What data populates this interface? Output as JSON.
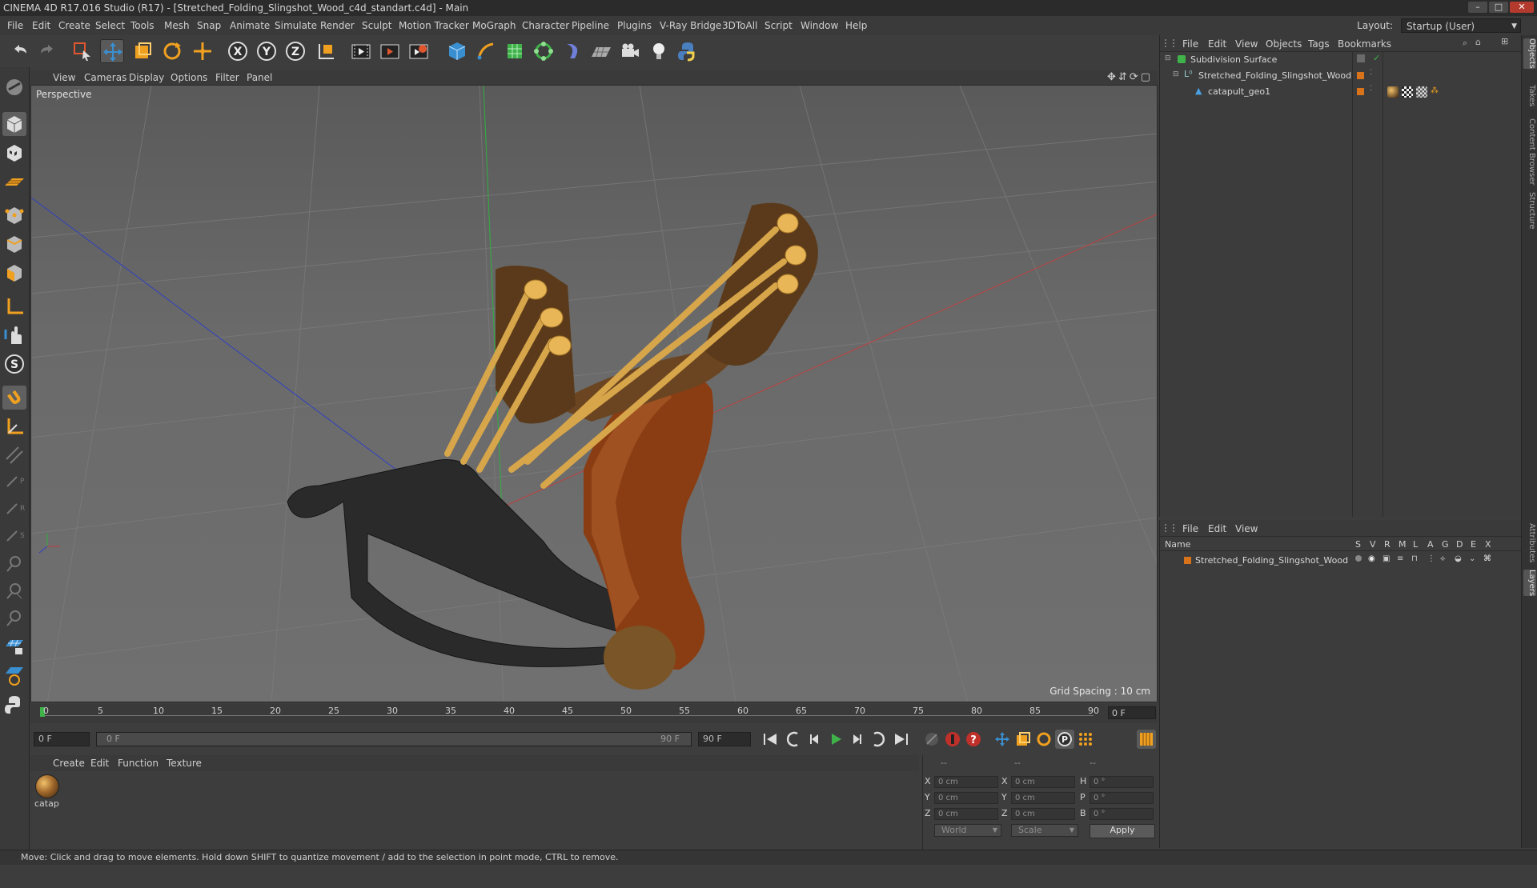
{
  "window": {
    "title": "CINEMA 4D R17.016 Studio (R17) - [Stretched_Folding_Slingshot_Wood_c4d_standart.c4d] - Main",
    "buttons": [
      "–",
      "□",
      "✕"
    ]
  },
  "menubar": {
    "items": [
      "File",
      "Edit",
      "Create",
      "Select",
      "Tools",
      "Mesh",
      "Snap",
      "Animate",
      "Simulate",
      "Render",
      "Sculpt",
      "Motion Tracker",
      "MoGraph",
      "Character",
      "Pipeline",
      "Plugins",
      "V-Ray Bridge",
      "3DToAll",
      "Script",
      "Window",
      "Help"
    ],
    "layout_label": "Layout:",
    "layout_value": "Startup (User)"
  },
  "toolbar": {
    "icons": [
      "undo-icon",
      "redo-icon",
      "live-selection-icon",
      "move-icon",
      "scale-icon",
      "rotate-icon",
      "add-icon",
      "x-axis-icon",
      "y-axis-icon",
      "z-axis-icon",
      "coordinate-system-icon",
      "render-view-icon",
      "render-picture-viewer-icon",
      "edit-render-settings-icon",
      "cube-icon",
      "pen-icon",
      "subdivision-icon",
      "array-icon",
      "deformer-icon",
      "floor-icon",
      "camera-icon",
      "light-icon",
      "python-icon"
    ],
    "axis_labels": [
      "X",
      "Y",
      "Z"
    ]
  },
  "viewport": {
    "menu": [
      "View",
      "Cameras",
      "Display",
      "Options",
      "Filter",
      "Panel"
    ],
    "label": "Perspective",
    "grid_spacing": "Grid Spacing : 10 cm"
  },
  "timeline": {
    "ticks": [
      "0",
      "5",
      "10",
      "15",
      "20",
      "25",
      "30",
      "35",
      "40",
      "45",
      "50",
      "55",
      "60",
      "65",
      "70",
      "75",
      "80",
      "85",
      "90"
    ],
    "current_frame_field": "0 F",
    "start_field": "0 F",
    "range_start": "0 F",
    "range_end": "90 F",
    "end_field": "90 F",
    "end_frame_right": "0 F"
  },
  "material_manager": {
    "menu": [
      "Create",
      "Edit",
      "Function",
      "Texture"
    ],
    "materials": [
      {
        "name": "catap"
      }
    ]
  },
  "coordinates": {
    "headers": [
      "--",
      "--",
      "--"
    ],
    "rows": [
      {
        "pos_label": "X",
        "pos": "0 cm",
        "size_label": "X",
        "size": "0 cm",
        "rot_label": "H",
        "rot": "0 °"
      },
      {
        "pos_label": "Y",
        "pos": "0 cm",
        "size_label": "Y",
        "size": "0 cm",
        "rot_label": "P",
        "rot": "0 °"
      },
      {
        "pos_label": "Z",
        "pos": "0 cm",
        "size_label": "Z",
        "size": "0 cm",
        "rot_label": "B",
        "rot": "0 °"
      }
    ],
    "space": "World",
    "mode": "Scale",
    "apply": "Apply"
  },
  "status": {
    "text": "Move: Click and drag to move elements. Hold down SHIFT to quantize movement / add to the selection in point mode, CTRL to remove."
  },
  "object_manager": {
    "menu": [
      "File",
      "Edit",
      "View",
      "Objects",
      "Tags",
      "Bookmarks"
    ],
    "objects": [
      {
        "name": "Subdivision Surface"
      },
      {
        "name": "Stretched_Folding_Slingshot_Wood"
      },
      {
        "name": "catapult_geo1"
      }
    ]
  },
  "layer_manager": {
    "menu": [
      "File",
      "Edit",
      "View"
    ],
    "columns": [
      "Name",
      "S",
      "V",
      "R",
      "M",
      "L",
      "A",
      "G",
      "D",
      "E",
      "X"
    ],
    "layers": [
      {
        "name": "Stretched_Folding_Slingshot_Wood",
        "color": "#d8731c"
      }
    ]
  },
  "right_tabs": [
    "Objects",
    "Takes",
    "Content Browser",
    "Structure",
    "Attributes",
    "Layers"
  ],
  "colors": {
    "accent": "#d8731c",
    "active_icon": "#3a8fd0"
  }
}
